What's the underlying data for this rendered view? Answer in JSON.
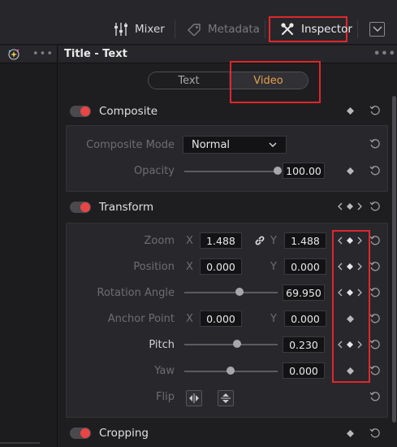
{
  "topbar": {
    "mixer_label": "Mixer",
    "metadata_label": "Metadata",
    "inspector_label": "Inspector"
  },
  "inspector": {
    "title": "Title - Text",
    "tabs": [
      "Text",
      "Video"
    ],
    "active_tab": "Video"
  },
  "composite": {
    "title": "Composite",
    "mode_label": "Composite Mode",
    "mode_value": "Normal",
    "opacity_label": "Opacity",
    "opacity_value": "100.00",
    "opacity_fraction": 1.0
  },
  "transform": {
    "title": "Transform",
    "zoom_label": "Zoom",
    "zoom_x": "1.488",
    "zoom_y": "1.488",
    "position_label": "Position",
    "position_x": "0.000",
    "position_y": "0.000",
    "rotation_label": "Rotation Angle",
    "rotation_value": "69.950",
    "anchor_label": "Anchor Point",
    "anchor_x": "0.000",
    "anchor_y": "0.000",
    "pitch_label": "Pitch",
    "pitch_value": "0.230",
    "yaw_label": "Yaw",
    "yaw_value": "0.000",
    "flip_label": "Flip",
    "axis_x": "X",
    "axis_y": "Y"
  },
  "cropping": {
    "title": "Cropping"
  },
  "colors": {
    "accent_orange": "#e6a04a",
    "toggle_red": "#e84545",
    "highlight_red": "#e0262b"
  }
}
